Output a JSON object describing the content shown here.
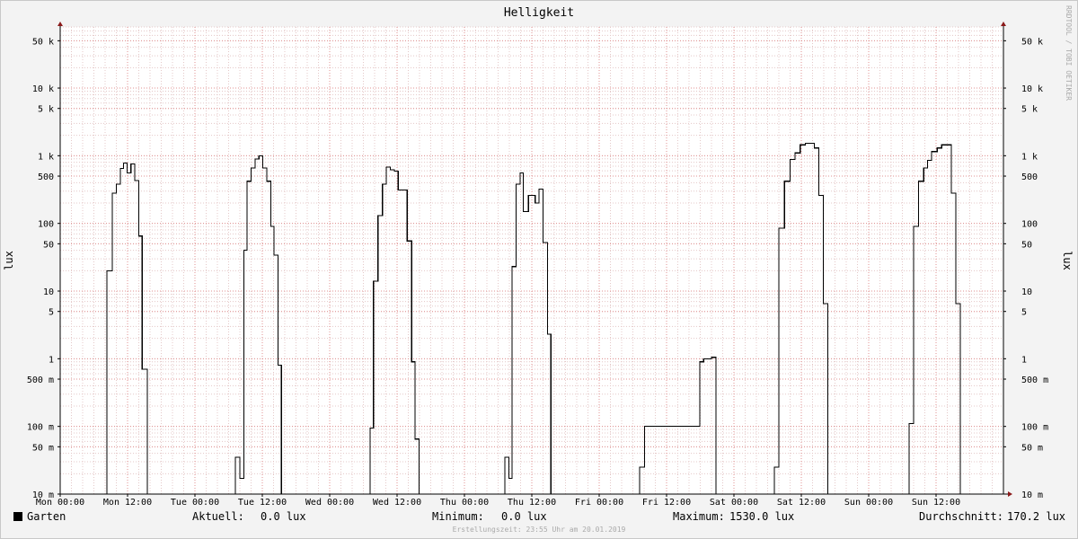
{
  "chart_data": {
    "type": "line",
    "title": "Helligkeit",
    "ylabel": "lux",
    "y_scale": "log",
    "ylim": [
      0.01,
      80000
    ],
    "grid": true,
    "x_ticks": [
      "Mon 00:00",
      "Mon 12:00",
      "Tue 00:00",
      "Tue 12:00",
      "Wed 00:00",
      "Wed 12:00",
      "Thu 00:00",
      "Thu 12:00",
      "Fri 00:00",
      "Fri 12:00",
      "Sat 00:00",
      "Sat 12:00",
      "Sun 00:00",
      "Sun 12:00"
    ],
    "y_ticks": [
      {
        "value": 50000,
        "label": "50 k"
      },
      {
        "value": 10000,
        "label": "10 k"
      },
      {
        "value": 5000,
        "label": "5 k"
      },
      {
        "value": 1000,
        "label": "1 k"
      },
      {
        "value": 500,
        "label": "500"
      },
      {
        "value": 100,
        "label": "100"
      },
      {
        "value": 50,
        "label": "50"
      },
      {
        "value": 10,
        "label": "10"
      },
      {
        "value": 5,
        "label": "5"
      },
      {
        "value": 1,
        "label": "1"
      },
      {
        "value": 0.5,
        "label": "500 m"
      },
      {
        "value": 0.1,
        "label": "100 m"
      },
      {
        "value": 0.05,
        "label": "50 m"
      },
      {
        "value": 0.01,
        "label": "10 m"
      }
    ],
    "series": [
      {
        "name": "Garten",
        "color": "#000000",
        "points": [
          [
            0,
            0.01
          ],
          [
            8.3,
            0.01
          ],
          [
            8.3,
            20
          ],
          [
            9.3,
            20
          ],
          [
            9.3,
            280
          ],
          [
            10,
            280
          ],
          [
            10,
            380
          ],
          [
            10.7,
            380
          ],
          [
            10.7,
            650
          ],
          [
            11.3,
            650
          ],
          [
            11.3,
            780
          ],
          [
            11.9,
            780
          ],
          [
            11.9,
            560
          ],
          [
            12.6,
            560
          ],
          [
            12.6,
            760
          ],
          [
            13.3,
            760
          ],
          [
            13.3,
            430
          ],
          [
            14,
            430
          ],
          [
            14,
            65
          ],
          [
            14.6,
            65
          ],
          [
            14.6,
            0.7
          ],
          [
            15.5,
            0.7
          ],
          [
            15.5,
            0.01
          ],
          [
            31.2,
            0.01
          ],
          [
            31.2,
            0.035
          ],
          [
            32,
            0.035
          ],
          [
            32,
            0.017
          ],
          [
            32.7,
            0.017
          ],
          [
            32.7,
            40
          ],
          [
            33.3,
            40
          ],
          [
            33.3,
            420
          ],
          [
            34,
            420
          ],
          [
            34,
            660
          ],
          [
            34.7,
            660
          ],
          [
            34.7,
            900
          ],
          [
            35.4,
            900
          ],
          [
            35.4,
            1000
          ],
          [
            36.1,
            1000
          ],
          [
            36.1,
            660
          ],
          [
            36.8,
            660
          ],
          [
            36.8,
            420
          ],
          [
            37.5,
            420
          ],
          [
            37.5,
            90
          ],
          [
            38.1,
            90
          ],
          [
            38.1,
            34
          ],
          [
            38.8,
            34
          ],
          [
            38.8,
            0.8
          ],
          [
            39.4,
            0.8
          ],
          [
            39.4,
            0.01
          ],
          [
            55.2,
            0.01
          ],
          [
            55.2,
            0.095
          ],
          [
            55.8,
            0.095
          ],
          [
            55.8,
            14
          ],
          [
            56.6,
            14
          ],
          [
            56.6,
            130
          ],
          [
            57.4,
            130
          ],
          [
            57.4,
            380
          ],
          [
            58.1,
            380
          ],
          [
            58.1,
            680
          ],
          [
            58.8,
            680
          ],
          [
            58.8,
            620
          ],
          [
            59.5,
            620
          ],
          [
            59.5,
            590
          ],
          [
            60.2,
            590
          ],
          [
            60.2,
            310
          ],
          [
            61.8,
            310
          ],
          [
            61.8,
            55
          ],
          [
            62.6,
            55
          ],
          [
            62.6,
            0.9
          ],
          [
            63.2,
            0.9
          ],
          [
            63.2,
            0.065
          ],
          [
            63.9,
            0.065
          ],
          [
            63.9,
            0.01
          ],
          [
            79.2,
            0.01
          ],
          [
            79.2,
            0.035
          ],
          [
            79.9,
            0.035
          ],
          [
            79.9,
            0.017
          ],
          [
            80.5,
            0.017
          ],
          [
            80.5,
            23
          ],
          [
            81.2,
            23
          ],
          [
            81.2,
            380
          ],
          [
            81.9,
            380
          ],
          [
            81.9,
            560
          ],
          [
            82.5,
            560
          ],
          [
            82.5,
            150
          ],
          [
            83.4,
            150
          ],
          [
            83.4,
            260
          ],
          [
            84.6,
            260
          ],
          [
            84.6,
            200
          ],
          [
            85.3,
            200
          ],
          [
            85.3,
            320
          ],
          [
            86,
            320
          ],
          [
            86,
            52
          ],
          [
            86.8,
            52
          ],
          [
            86.8,
            2.3
          ],
          [
            87.4,
            2.3
          ],
          [
            87.4,
            0.01
          ],
          [
            103.2,
            0.01
          ],
          [
            103.2,
            0.025
          ],
          [
            104.1,
            0.025
          ],
          [
            104.1,
            0.1
          ],
          [
            113.9,
            0.1
          ],
          [
            113.9,
            0.9
          ],
          [
            114.6,
            0.9
          ],
          [
            114.6,
            1.0
          ],
          [
            116,
            1.0
          ],
          [
            116,
            1.05
          ],
          [
            116.8,
            1.05
          ],
          [
            116.8,
            0.01
          ],
          [
            127.2,
            0.01
          ],
          [
            127.2,
            0.025
          ],
          [
            128,
            0.025
          ],
          [
            128,
            85
          ],
          [
            129,
            85
          ],
          [
            129,
            420
          ],
          [
            130,
            420
          ],
          [
            130,
            880
          ],
          [
            130.9,
            880
          ],
          [
            130.9,
            1100
          ],
          [
            131.8,
            1100
          ],
          [
            131.8,
            1450
          ],
          [
            132.7,
            1450
          ],
          [
            132.7,
            1530
          ],
          [
            134.3,
            1530
          ],
          [
            134.3,
            1300
          ],
          [
            135.1,
            1300
          ],
          [
            135.1,
            260
          ],
          [
            135.9,
            260
          ],
          [
            135.9,
            6.5
          ],
          [
            136.7,
            6.5
          ],
          [
            136.7,
            0.01
          ],
          [
            151.2,
            0.01
          ],
          [
            151.2,
            0.11
          ],
          [
            152,
            0.11
          ],
          [
            152,
            90
          ],
          [
            152.9,
            90
          ],
          [
            152.9,
            420
          ],
          [
            153.8,
            420
          ],
          [
            153.8,
            660
          ],
          [
            154.5,
            660
          ],
          [
            154.5,
            850
          ],
          [
            155.2,
            850
          ],
          [
            155.2,
            1150
          ],
          [
            156.2,
            1150
          ],
          [
            156.2,
            1300
          ],
          [
            157,
            1300
          ],
          [
            157,
            1450
          ],
          [
            158.7,
            1450
          ],
          [
            158.7,
            280
          ],
          [
            159.5,
            280
          ],
          [
            159.5,
            6.5
          ],
          [
            160.3,
            6.5
          ],
          [
            160.3,
            0.01
          ],
          [
            168,
            0.01
          ]
        ]
      }
    ]
  },
  "legend": {
    "series_name": "Garten",
    "swatch_color": "#000000",
    "current_label": "Aktuell:",
    "current_value": "0.0 lux",
    "min_label": "Minimum:",
    "min_value": "0.0 lux",
    "max_label": "Maximum:",
    "max_value": "1530.0 lux",
    "avg_label": "Durchschnitt:",
    "avg_value": "170.2 lux"
  },
  "watermark": "RRDTOOL / TOBI OETIKER",
  "footer": "Erstellungszeit: 23:55 Uhr am 20.01.2019"
}
